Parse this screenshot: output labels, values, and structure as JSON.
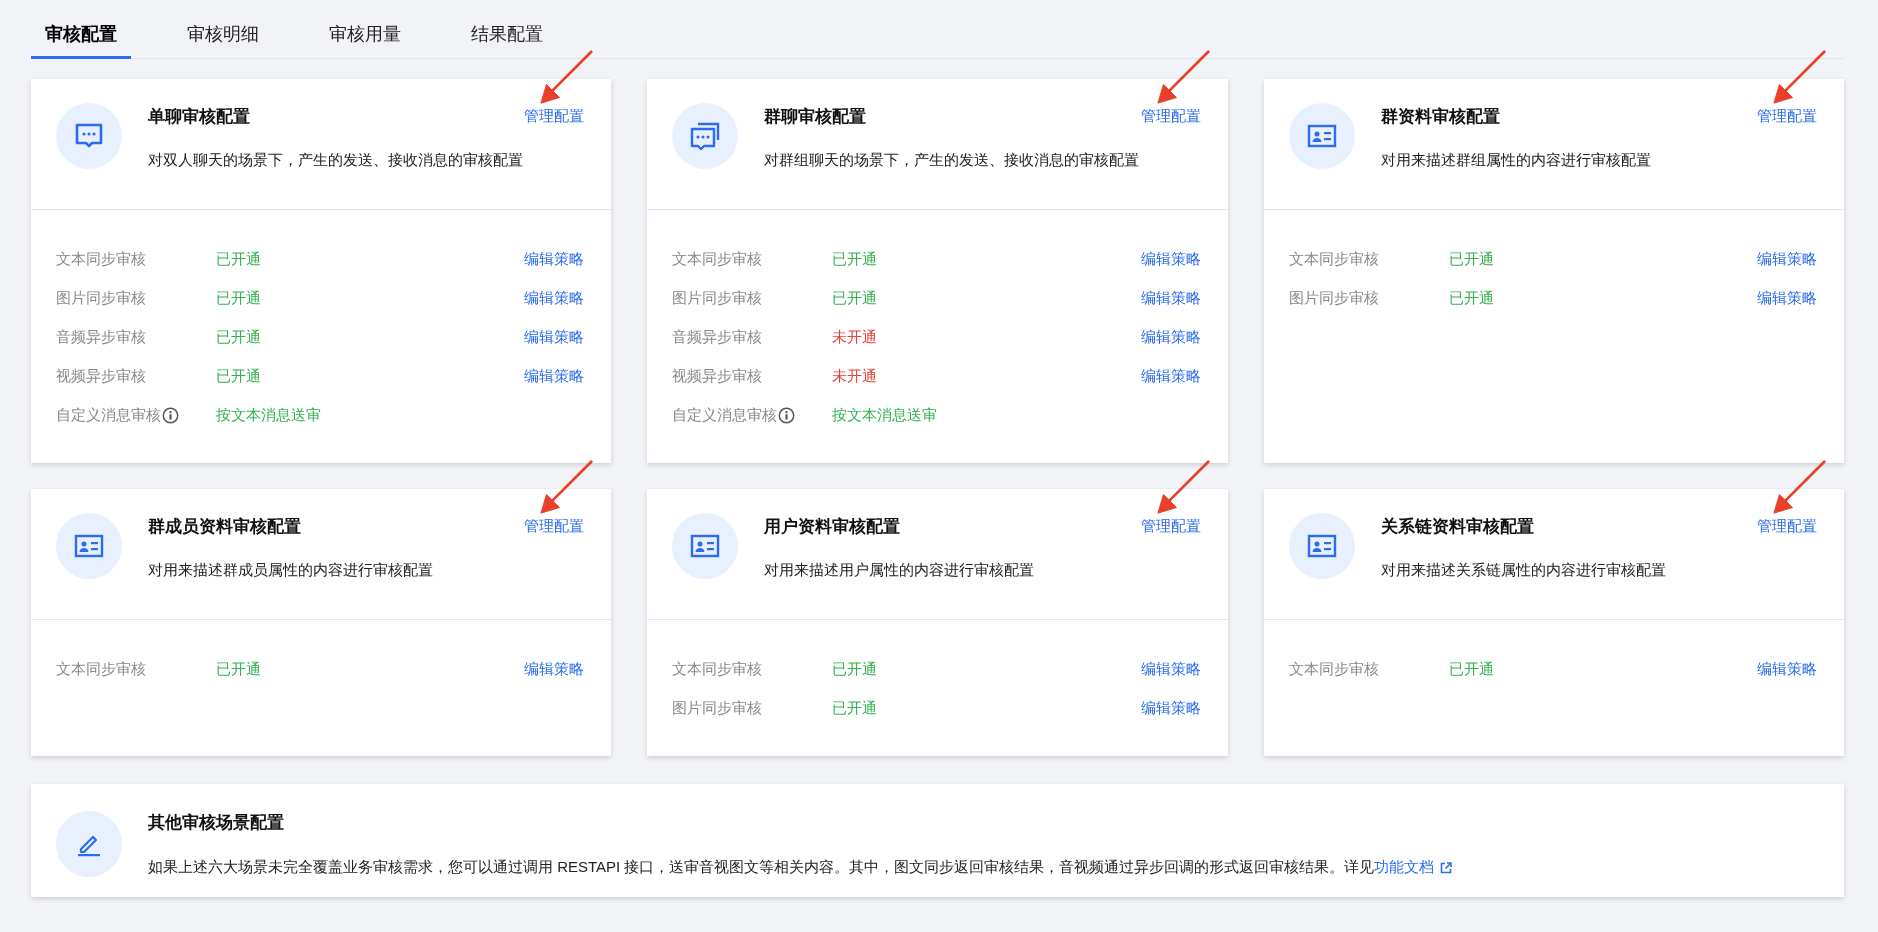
{
  "tabs": [
    {
      "label": "审核配置",
      "selected": true
    },
    {
      "label": "审核明细",
      "selected": false
    },
    {
      "label": "审核用量",
      "selected": false
    },
    {
      "label": "结果配置",
      "selected": false
    }
  ],
  "cards": [
    {
      "kind": "chat",
      "title": "单聊审核配置",
      "action": "管理配置",
      "highlighted": true,
      "description": "对双人聊天的场景下，产生的发送、接收消息的审核配置",
      "rows": [
        {
          "label": "文本同步审核",
          "info": false,
          "status": "已开通",
          "enabled": true,
          "action": "编辑策略"
        },
        {
          "label": "图片同步审核",
          "info": false,
          "status": "已开通",
          "enabled": true,
          "action": "编辑策略"
        },
        {
          "label": "音频异步审核",
          "info": false,
          "status": "已开通",
          "enabled": true,
          "action": "编辑策略"
        },
        {
          "label": "视频异步审核",
          "info": false,
          "status": "已开通",
          "enabled": true,
          "action": "编辑策略"
        },
        {
          "label": "自定义消息审核",
          "info": true,
          "status": "按文本消息送审",
          "enabled": true
        }
      ]
    },
    {
      "kind": "group-chat",
      "title": "群聊审核配置",
      "action": "管理配置",
      "highlighted": true,
      "description": "对群组聊天的场景下，产生的发送、接收消息的审核配置",
      "rows": [
        {
          "label": "文本同步审核",
          "info": false,
          "status": "已开通",
          "enabled": true,
          "action": "编辑策略"
        },
        {
          "label": "图片同步审核",
          "info": false,
          "status": "已开通",
          "enabled": true,
          "action": "编辑策略"
        },
        {
          "label": "音频异步审核",
          "info": false,
          "status": "未开通",
          "enabled": false,
          "action": "编辑策略"
        },
        {
          "label": "视频异步审核",
          "info": false,
          "status": "未开通",
          "enabled": false,
          "action": "编辑策略"
        },
        {
          "label": "自定义消息审核",
          "info": true,
          "status": "按文本消息送审",
          "enabled": true
        }
      ]
    },
    {
      "kind": "profile",
      "title": "群资料审核配置",
      "action": "管理配置",
      "highlighted": true,
      "description": "对用来描述群组属性的内容进行审核配置",
      "rows": [
        {
          "label": "文本同步审核",
          "info": false,
          "status": "已开通",
          "enabled": true,
          "action": "编辑策略"
        },
        {
          "label": "图片同步审核",
          "info": false,
          "status": "已开通",
          "enabled": true,
          "action": "编辑策略"
        }
      ]
    },
    {
      "kind": "profile",
      "title": "群成员资料审核配置",
      "action": "管理配置",
      "highlighted": true,
      "description": "对用来描述群成员属性的内容进行审核配置",
      "rows": [
        {
          "label": "文本同步审核",
          "info": false,
          "status": "已开通",
          "enabled": true,
          "action": "编辑策略"
        }
      ]
    },
    {
      "kind": "profile",
      "title": "用户资料审核配置",
      "action": "管理配置",
      "highlighted": true,
      "description": "对用来描述用户属性的内容进行审核配置",
      "rows": [
        {
          "label": "文本同步审核",
          "info": false,
          "status": "已开通",
          "enabled": true,
          "action": "编辑策略"
        },
        {
          "label": "图片同步审核",
          "info": false,
          "status": "已开通",
          "enabled": true,
          "action": "编辑策略"
        }
      ]
    },
    {
      "kind": "profile",
      "title": "关系链资料审核配置",
      "action": "管理配置",
      "highlighted": true,
      "description": "对用来描述关系链属性的内容进行审核配置",
      "rows": [
        {
          "label": "文本同步审核",
          "info": false,
          "status": "已开通",
          "enabled": true,
          "action": "编辑策略"
        }
      ]
    }
  ],
  "other": {
    "kind": "edit",
    "title": "其他审核场景配置",
    "description": "如果上述六大场景未完全覆盖业务审核需求，您可以通过调用 RESTAPI 接口，送审音视图文等相关内容。其中，图文同步返回审核结果，音视频通过异步回调的形式返回审核结果。详见",
    "link": "功能文档"
  }
}
